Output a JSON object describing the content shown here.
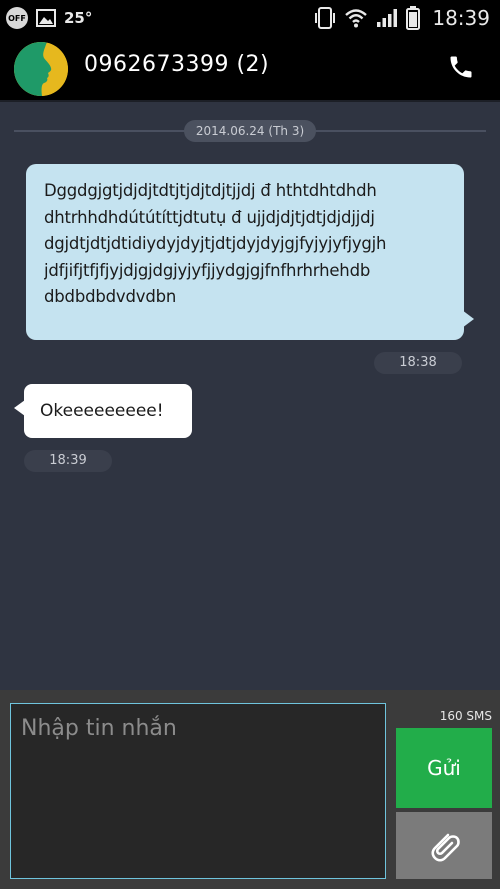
{
  "status_bar": {
    "off_badge": "OFF",
    "temperature": "25°",
    "time": "18:39",
    "icons": [
      "power-saving-off-icon",
      "gallery-notification-icon",
      "vibrate-icon",
      "wifi-icon",
      "signal-icon",
      "battery-icon"
    ]
  },
  "header": {
    "contact_title": "0962673399 (2)",
    "avatar_icon": "contact-avatar-icon",
    "call_icon": "phone-icon"
  },
  "conversation": {
    "date_separator": "2014.06.24 (Th 3)",
    "outgoing": {
      "lines": [
        "Dggdgjgtjdjdjtdtjtjdjtdjtjjdj đ hthtdhtdhdh",
        "dhtrhhdhdútútíttjdtutụ đ ujjdjdjtjdtjdjdjjdj",
        "dgjdtjdtjdtidiydyjdyjtjdtjdyjdyjgjfyjyjyfjygjh",
        "jdfjifjtfjfjyjdjgjdgjyjyfjjydgjgjfnfhrhrhehdb",
        "dbdbdbdvdvdbn"
      ],
      "time": "18:38"
    },
    "incoming": {
      "text": "Okeeeeeeeee!",
      "time": "18:39"
    }
  },
  "composer": {
    "placeholder": "Nhập tin nhắn",
    "value": "",
    "counter": "160  SMS",
    "send_label": "Gửi",
    "attach_icon": "paperclip-icon"
  },
  "colors": {
    "background": "#2f3441",
    "outgoing_bubble": "#c5e3f0",
    "incoming_bubble": "#ffffff",
    "send_button": "#22ad4a",
    "attach_button": "#7b7b7b",
    "input_border": "#6fc4dd"
  }
}
